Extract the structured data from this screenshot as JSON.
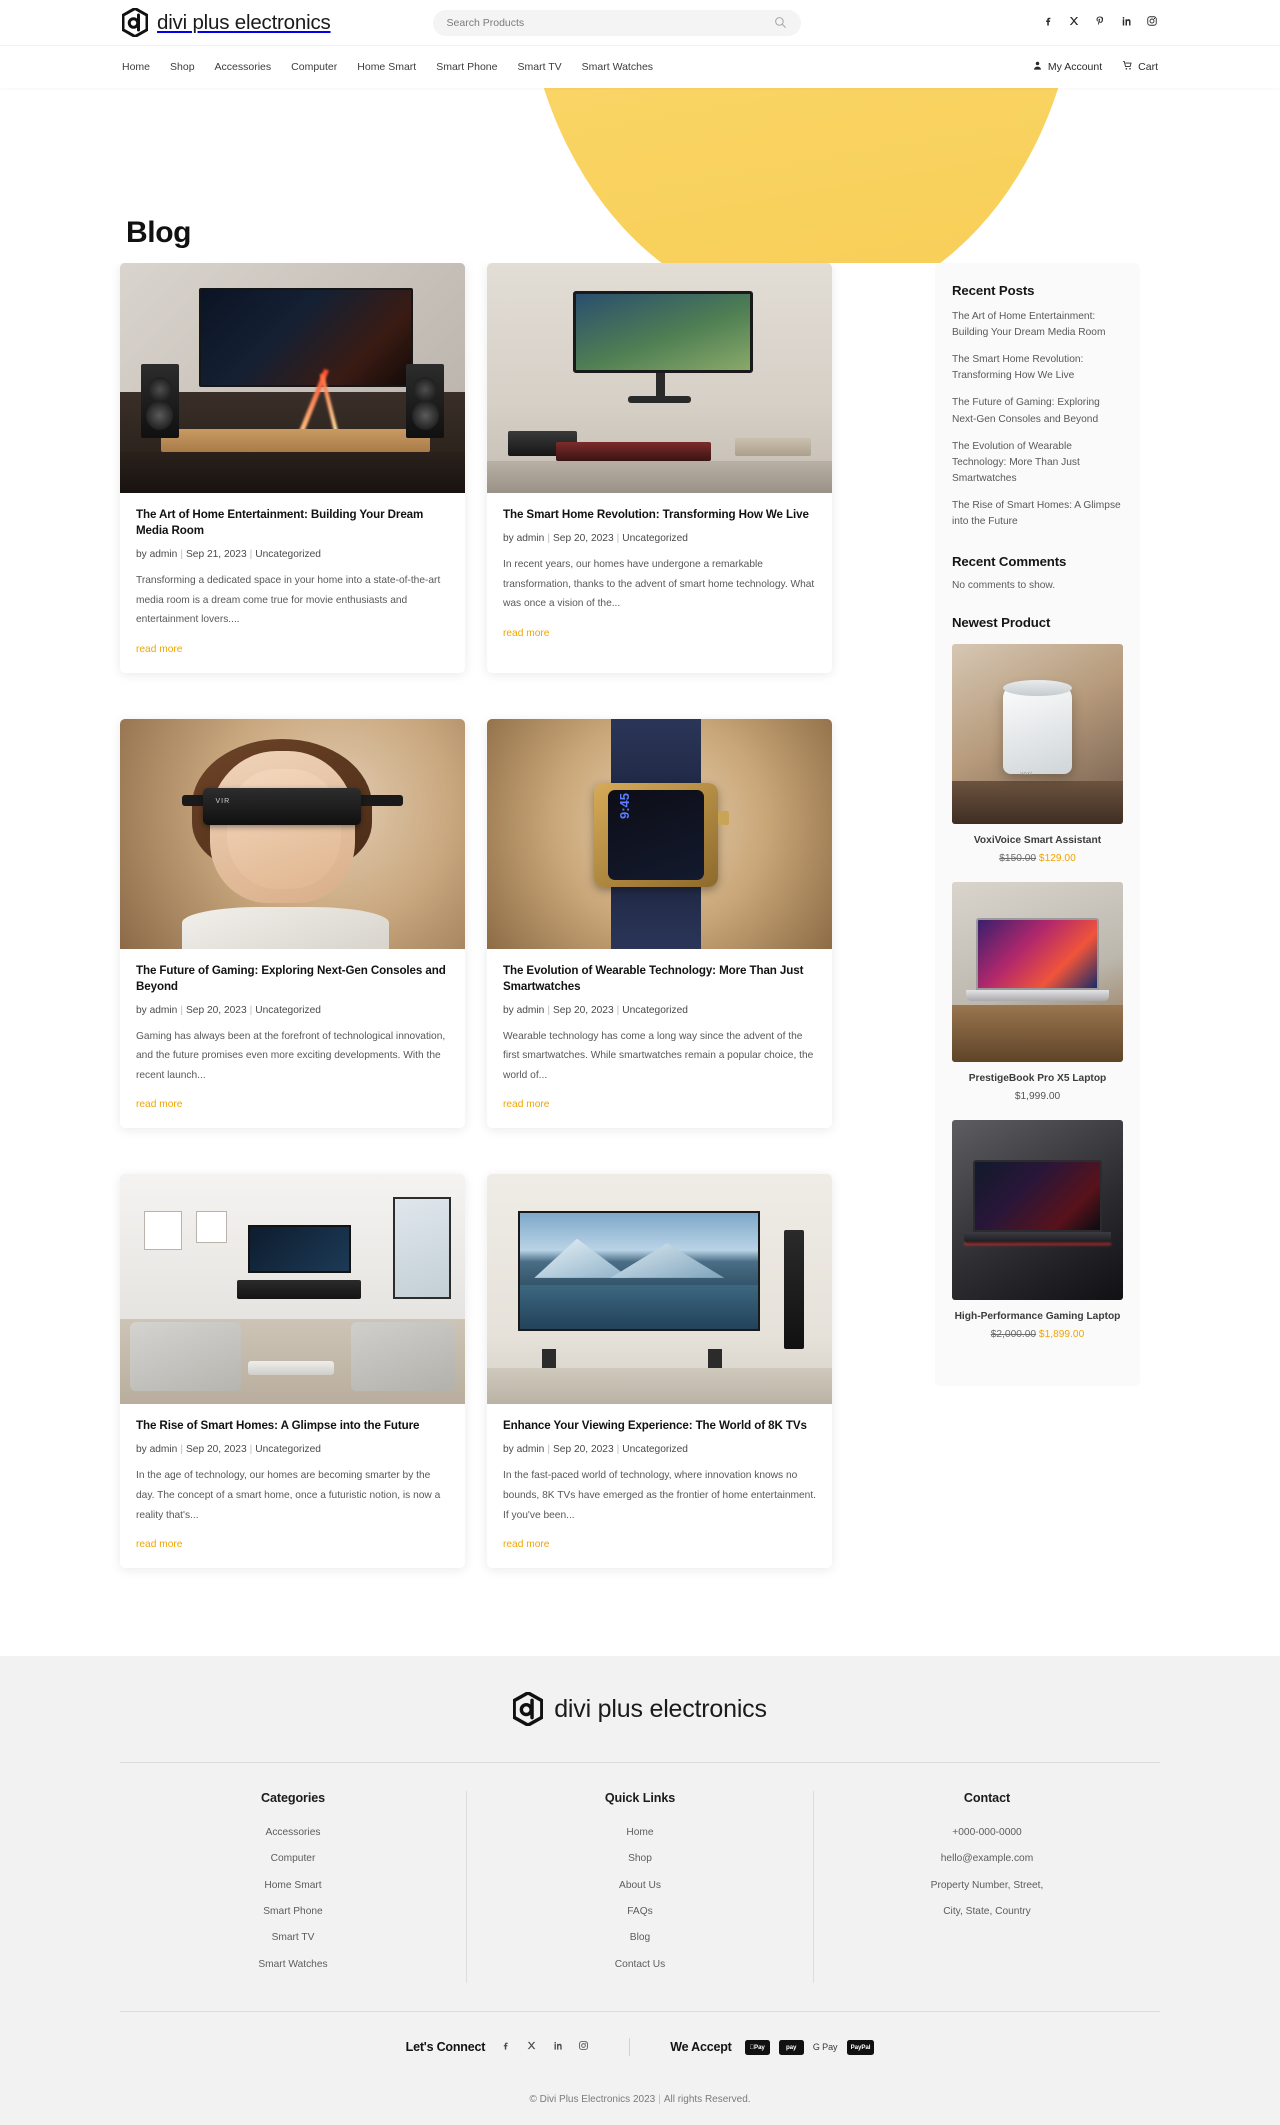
{
  "site": {
    "brand": "divi plus electronics",
    "logo_icon": "hexagon-d-logo"
  },
  "header": {
    "search": {
      "placeholder": "Search Products",
      "value": "",
      "icon": "search-icon"
    },
    "social": [
      {
        "name": "facebook-icon",
        "glyph": "f"
      },
      {
        "name": "x-twitter-icon",
        "glyph": "X"
      },
      {
        "name": "pinterest-icon",
        "glyph": "P"
      },
      {
        "name": "linkedin-icon",
        "glyph": "in"
      },
      {
        "name": "instagram-icon",
        "glyph": "IG"
      }
    ],
    "nav": [
      {
        "label": "Home"
      },
      {
        "label": "Shop"
      },
      {
        "label": "Accessories"
      },
      {
        "label": "Computer"
      },
      {
        "label": "Home Smart"
      },
      {
        "label": "Smart Phone"
      },
      {
        "label": "Smart TV"
      },
      {
        "label": "Smart Watches"
      }
    ],
    "account_label": "My Account",
    "cart_label": "Cart"
  },
  "hero": {
    "title": "Blog",
    "accent_color": "#f7d062"
  },
  "posts": [
    {
      "title": "The Art of Home Entertainment: Building Your Dream Media Room",
      "author": "by admin",
      "date": "Sep 21, 2023",
      "category": "Uncategorized",
      "excerpt": "Transforming a dedicated space in your home into a state-of-the-art media room is a dream come true for movie enthusiasts and entertainment lovers....",
      "read_more": "read more",
      "image_alt": "home-theater-with-tv-and-speakers"
    },
    {
      "title": "The Smart Home Revolution: Transforming How We Live",
      "author": "by admin",
      "date": "Sep 20, 2023",
      "category": "Uncategorized",
      "excerpt": "In recent years, our homes have undergone a remarkable transformation, thanks to the advent of smart home technology. What was once a vision of the...",
      "read_more": "read more",
      "image_alt": "desk-with-monitor-and-keyboard"
    },
    {
      "title": "The Future of Gaming: Exploring Next-Gen Consoles and Beyond",
      "author": "by admin",
      "date": "Sep 20, 2023",
      "category": "Uncategorized",
      "excerpt": "Gaming has always been at the forefront of technological innovation, and the future promises even more exciting developments. With the recent launch...",
      "read_more": "read more",
      "image_alt": "person-wearing-vr-headset"
    },
    {
      "title": "The Evolution of Wearable Technology: More Than Just Smartwatches",
      "author": "by admin",
      "date": "Sep 20, 2023",
      "category": "Uncategorized",
      "excerpt": "Wearable technology has come a long way since the advent of the first smartwatches. While smartwatches remain a popular choice, the world of...",
      "read_more": "read more",
      "image_alt": "gold-smartwatch-with-blue-band"
    },
    {
      "title": "The Rise of Smart Homes: A Glimpse into the Future",
      "author": "by admin",
      "date": "Sep 20, 2023",
      "category": "Uncategorized",
      "excerpt": "In the age of technology, our homes are becoming smarter by the day. The concept of a smart home, once a futuristic notion, is now a reality that's...",
      "read_more": "read more",
      "image_alt": "modern-living-room-with-tv"
    },
    {
      "title": "Enhance Your Viewing Experience: The World of 8K TVs",
      "author": "by admin",
      "date": "Sep 20, 2023",
      "category": "Uncategorized",
      "excerpt": "In the fast-paced world of technology, where innovation knows no bounds, 8K TVs have emerged as the frontier of home entertainment. If you've been...",
      "read_more": "read more",
      "image_alt": "large-8k-tv-showing-mountain-lake"
    }
  ],
  "sidebar": {
    "recent_posts_heading": "Recent Posts",
    "recent_posts": [
      "The Art of Home Entertainment: Building Your Dream Media Room",
      "The Smart Home Revolution: Transforming How We Live",
      "The Future of Gaming: Exploring Next-Gen Consoles and Beyond",
      "The Evolution of Wearable Technology: More Than Just Smartwatches",
      "The Rise of Smart Homes: A Glimpse into the Future"
    ],
    "recent_comments_heading": "Recent Comments",
    "no_comments": "No comments to show.",
    "newest_product_heading": "Newest Product",
    "products": [
      {
        "name": "VoxiVoice Smart Assistant",
        "old_price": "$150.00",
        "price": "$129.00",
        "image_alt": "white-cylindrical-smart-speaker"
      },
      {
        "name": "PrestigeBook Pro X5 Laptop",
        "old_price": "",
        "price": "$1,999.00",
        "image_alt": "silver-laptop-with-colorful-screen"
      },
      {
        "name": "High-Performance Gaming Laptop",
        "old_price": "$2,000.00",
        "price": "$1,899.00",
        "image_alt": "black-gaming-laptop"
      }
    ]
  },
  "footer": {
    "columns": [
      {
        "heading": "Categories",
        "links": [
          "Accessories",
          "Computer",
          "Home Smart",
          "Smart Phone",
          "Smart TV",
          "Smart Watches"
        ]
      },
      {
        "heading": "Quick Links",
        "links": [
          "Home",
          "Shop",
          "About Us",
          "FAQs",
          "Blog",
          "Contact Us"
        ]
      }
    ],
    "contact": {
      "heading": "Contact",
      "phone": "+000-000-0000",
      "email": "hello@example.com",
      "address_line1": "Property Number, Street,",
      "address_line2": "City, State, Country"
    },
    "connect_label": "Let's Connect",
    "connect_social": [
      {
        "name": "facebook-icon"
      },
      {
        "name": "x-twitter-icon"
      },
      {
        "name": "linkedin-icon"
      },
      {
        "name": "instagram-icon"
      }
    ],
    "accept_label": "We Accept",
    "payments": [
      {
        "name": "apple-pay-icon",
        "label": "Pay"
      },
      {
        "name": "amazon-pay-icon",
        "label": "pay"
      },
      {
        "name": "google-pay-icon",
        "label": "G Pay"
      },
      {
        "name": "paypal-icon",
        "label": "PayPal"
      }
    ],
    "copyright": "© Divi Plus Electronics 2023",
    "copyright_sep": "|",
    "copyright_rights": "All rights Reserved."
  }
}
